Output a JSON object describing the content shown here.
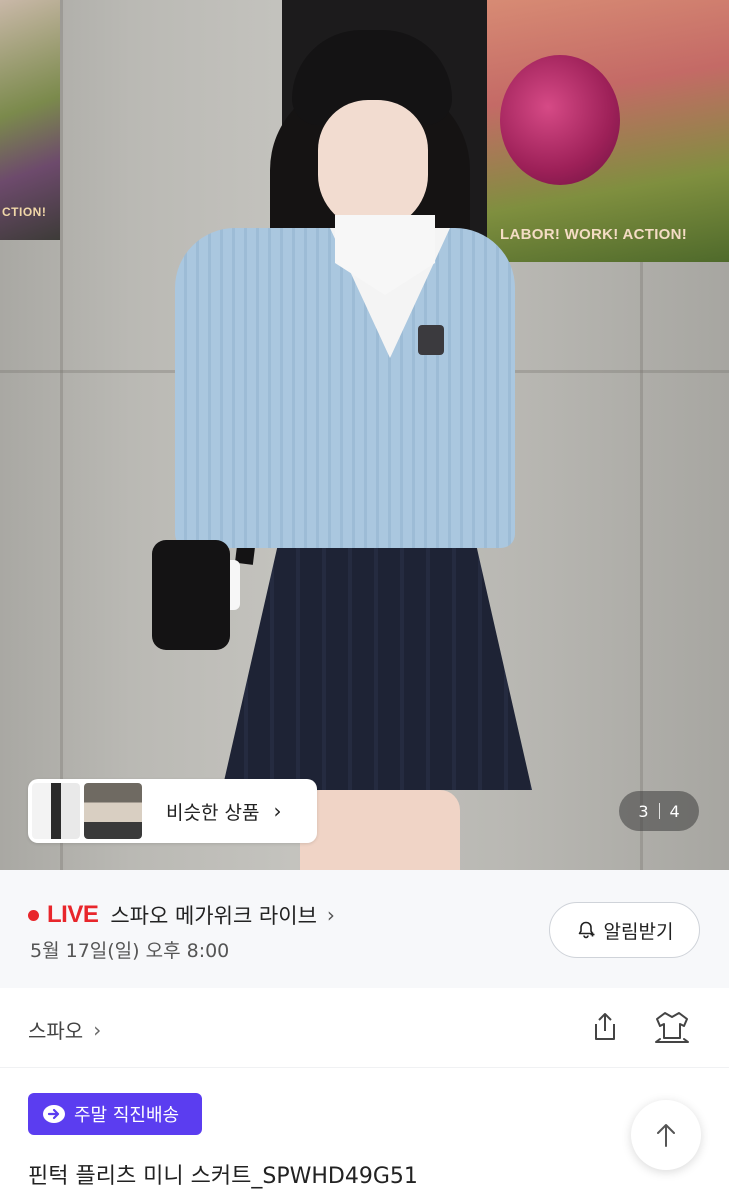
{
  "photo": {
    "poster_left_text": "CTION!",
    "poster_right_text": "LABOR! WORK! ACTION!",
    "similar_items": {
      "label": "비슷한 상품",
      "arrow": "›"
    },
    "page_counter": {
      "current": "3",
      "total": "4"
    }
  },
  "live": {
    "tag": "LIVE",
    "title": "스파오 메가위크 라이브",
    "chevron": "›",
    "datetime": "5월 17일(일) 오후 8:00",
    "alarm_label": "알림받기",
    "accent_color": "#e8262b"
  },
  "brand": {
    "name": "스파오",
    "chevron": "›",
    "icons": [
      "share-icon",
      "hanger-fitting-icon"
    ]
  },
  "product": {
    "delivery_badge": "주말 직진배송",
    "badge_color": "#5b3df0",
    "name": "핀턱 플리츠 미니 스커트_SPWHD49G51"
  },
  "scroll_top": {
    "icon": "arrow-up-icon"
  }
}
